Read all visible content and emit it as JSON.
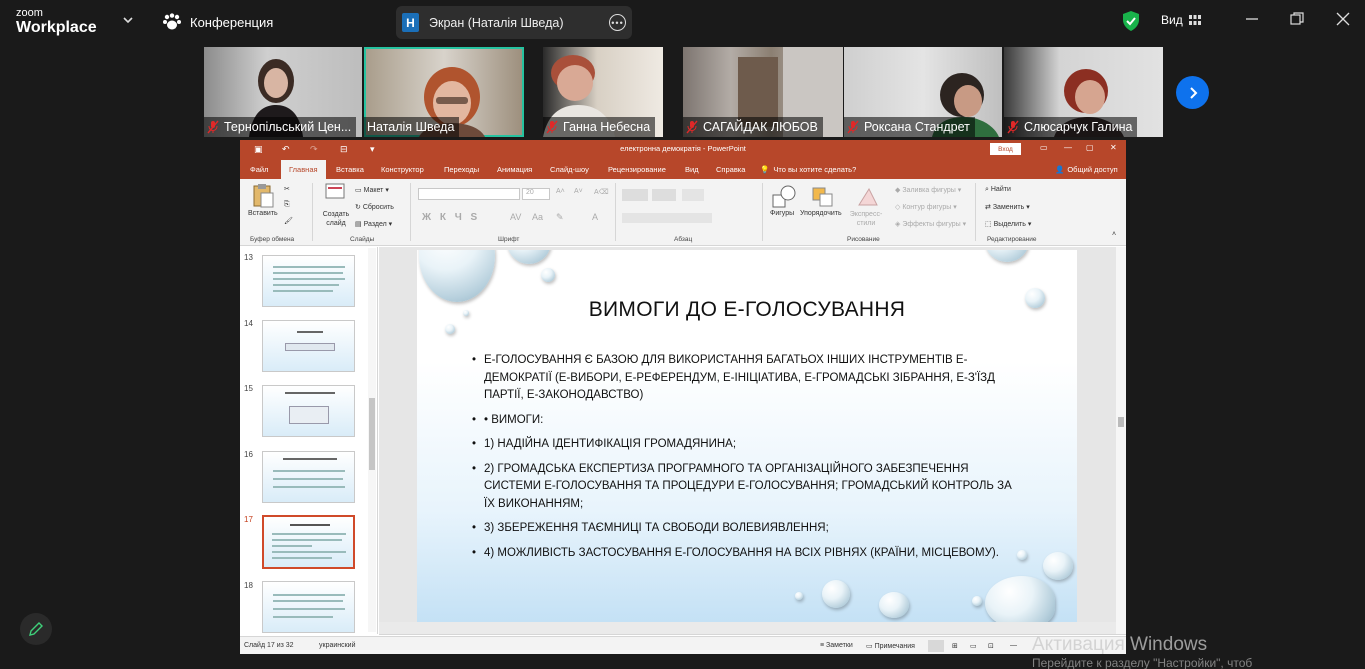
{
  "zoom": {
    "logo_top": "zoom",
    "logo_bottom": "Workplace",
    "conference_label": "Конференция",
    "screen_badge": "Н",
    "screen_share_label": "Экран (Наталія Шведа)",
    "view_label": "Вид",
    "accent": "#0e72ed",
    "active_border": "#26c3a0"
  },
  "participants": [
    {
      "name": "Тернопільський Цен..."
    },
    {
      "name": "Наталія Шведа"
    },
    {
      "name": "Ганна Небесна"
    },
    {
      "name": "САГАЙДАК ЛЮБОВ"
    },
    {
      "name": "Роксана Стандрет"
    },
    {
      "name": "Слюсарчук Галина"
    }
  ],
  "ppt": {
    "brand_color": "#b7472a",
    "window_title": "електронна демократія  -  PowerPoint",
    "signin_label": "Вход",
    "tabs": [
      "Файл",
      "Главная",
      "Вставка",
      "Конструктор",
      "Переходы",
      "Анимация",
      "Слайд-шоу",
      "Рецензирование",
      "Вид",
      "Справка",
      "Что вы хотите сделать?",
      "Общий доступ"
    ],
    "ribbon": {
      "paste": "Вставить",
      "clipboard_group": "Буфер обмена",
      "new_slide": "Создать слайд",
      "layout": "Макет",
      "reset": "Сбросить",
      "section": "Раздел",
      "slides_group": "Слайды",
      "font_size": "20",
      "font_group": "Шрифт",
      "font_buttons": "Ж  К  Ч  S",
      "paragraph_group": "Абзац",
      "shapes": "Фигуры",
      "arrange": "Упорядочить",
      "quick_styles": "Экспресс-стили",
      "fill": "Заливка фигуры",
      "outline": "Контур фигуры",
      "effects": "Эффекты фигуры",
      "drawing_group": "Рисование",
      "find": "Найти",
      "replace": "Заменить",
      "select": "Выделить",
      "editing_group": "Редактирование"
    },
    "slide_numbers": [
      "13",
      "14",
      "15",
      "16",
      "17",
      "18"
    ],
    "current_slide": "17",
    "slide": {
      "title": "ВИМОГИ ДО Е-ГОЛОСУВАННЯ",
      "bullets": [
        "Е-ГОЛОСУВАННЯ Є БАЗОЮ ДЛЯ ВИКОРИСТАННЯ БАГАТЬОХ ІНШИХ ІНСТРУМЕНТІВ Е-ДЕМОКРАТІЇ (Е-ВИБОРИ, Е-РЕФЕРЕНДУМ, Е-ІНІЦІАТИВА, Е-ГРОМАДСЬКІ ЗІБРАННЯ, Е-З'ЇЗД ПАРТІЇ, Е-ЗАКОНОДАВСТВО)",
        "• ВИМОГИ:",
        "1) НАДІЙНА ІДЕНТИФІКАЦІЯ ГРОМАДЯНИНА;",
        "2) ГРОМАДСЬКА ЕКСПЕРТИЗА ПРОГРАМНОГО ТА ОРГАНІЗАЦІЙНОГО ЗАБЕЗПЕЧЕННЯ СИСТЕМИ Е-ГОЛОСУВАННЯ ТА ПРОЦЕДУРИ Е-ГОЛОСУВАННЯ; ГРОМАДСЬКИЙ КОНТРОЛЬ ЗА ЇХ ВИКОНАННЯМ;",
        "3) ЗБЕРЕЖЕННЯ ТАЄМНИЦІ ТА СВОБОДИ ВОЛЕВИЯВЛЕННЯ;",
        "4) МОЖЛИВІСТЬ ЗАСТОСУВАННЯ Е-ГОЛОСУВАННЯ НА ВСІХ РІВНЯХ (КРАЇНИ, МІСЦЕВОМУ)."
      ]
    },
    "status": {
      "slide_count": "Слайд 17 из 32",
      "language": "украинский",
      "notes": "Заметки",
      "comments": "Примечания"
    }
  },
  "watermark": {
    "line1": "Активация Windows",
    "line2": "Перейдите к разделу \"Настройки\", чтоб"
  }
}
